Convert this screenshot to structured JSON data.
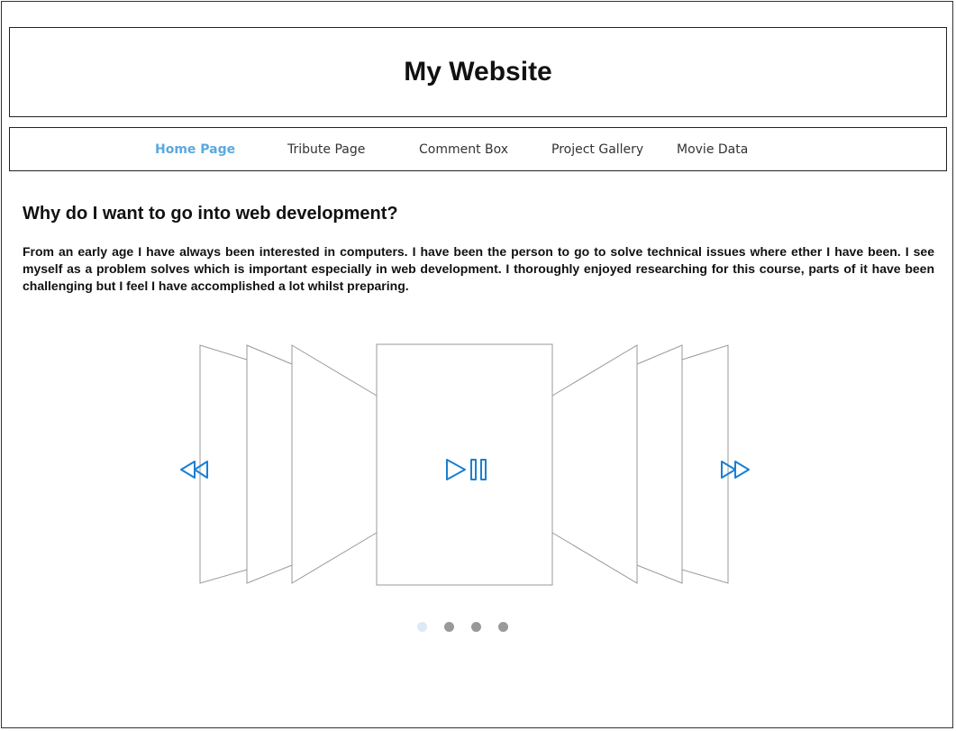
{
  "header": {
    "title": "My Website"
  },
  "nav": {
    "items": [
      {
        "label": "Home Page",
        "active": true
      },
      {
        "label": "Tribute Page",
        "active": false
      },
      {
        "label": "Comment Box",
        "active": false
      },
      {
        "label": "Project Gallery",
        "active": false
      },
      {
        "label": "Movie Data",
        "active": false
      }
    ]
  },
  "main": {
    "heading": "Why do I want to go into web development?",
    "paragraph": "From an early age I have always been interested in computers. I have been the person to go to solve technical issues where ether I have been. I see myself as a problem solves which is important especially in web development. I thoroughly enjoyed researching for this course, parts of it have been challenging but I feel I have accomplished a lot whilst preparing."
  },
  "carousel": {
    "prev_icon": "rewind-icon",
    "play_icon": "play-pause-icon",
    "next_icon": "fast-forward-icon",
    "accent_color": "#1a7fd4",
    "active_dot_color": "#dce9f7",
    "dot_color": "#999999",
    "dots_count": 4,
    "active_dot": 0
  }
}
